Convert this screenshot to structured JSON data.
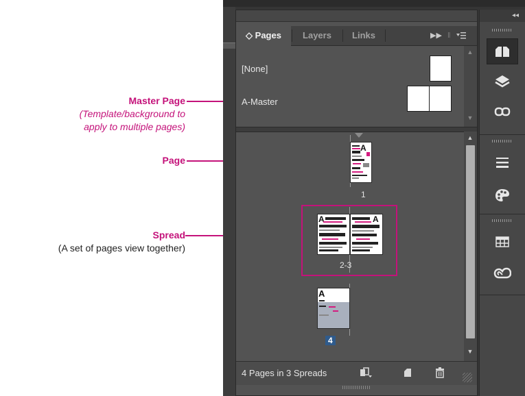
{
  "annotations": {
    "master_title": "Master Page",
    "master_desc_1": "(Template/background to",
    "master_desc_2": "apply to multiple pages)",
    "page_title": "Page",
    "spread_title": "Spread",
    "spread_desc": "(A set of pages view together)"
  },
  "panel": {
    "tabs": [
      {
        "label": "Pages",
        "prefix": "◇",
        "active": true
      },
      {
        "label": "Layers",
        "active": false
      },
      {
        "label": "Links",
        "active": false
      }
    ],
    "masters": [
      {
        "label": "[None]"
      },
      {
        "label": "A-Master"
      }
    ],
    "pages": [
      {
        "number": "1",
        "master_letter": "A"
      },
      {
        "number": "2-3",
        "master_letter_left": "A",
        "master_letter_right": "A"
      },
      {
        "number": "4",
        "master_letter": "A",
        "selected": true
      }
    ],
    "footer_text": "4 Pages in 3 Spreads"
  },
  "dock": {
    "collapse_label": "◂◂",
    "icons": [
      "pages-icon",
      "layers-icon",
      "links-icon",
      "stroke-icon",
      "swatches-icon",
      "table-icon",
      "creative-cloud-icon"
    ]
  },
  "colors": {
    "annotation": "#c4127a",
    "panel_bg": "#535353",
    "selection": "#2f5b8c"
  }
}
